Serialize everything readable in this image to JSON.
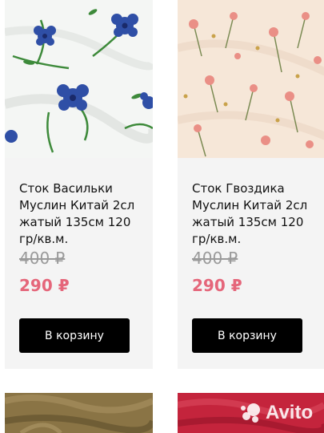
{
  "products": [
    {
      "title": "Сток Васильки Муслин Китай 2сл жатый 135см 120 гр/кв.м.",
      "old_price": "400 ₽",
      "new_price": "290 ₽",
      "button_label": "В корзину",
      "image": "cornflower-muslin-fabric-photo"
    },
    {
      "title": "Сток Гвоздика Муслин Китай 2сл жатый 135см 120 гр/кв.м.",
      "old_price": "400 ₽",
      "new_price": "290 ₽",
      "button_label": "В корзину",
      "image": "carnation-muslin-fabric-photo"
    }
  ],
  "more_products_images": [
    "olive-muslin-fabric-photo",
    "crimson-muslin-fabric-photo"
  ],
  "watermark": "Avito",
  "colors": {
    "card_background": "#f4f4f4",
    "new_price": "#e5667a",
    "old_price": "#9a9a9a",
    "button_background": "#000000",
    "button_text": "#ffffff"
  }
}
